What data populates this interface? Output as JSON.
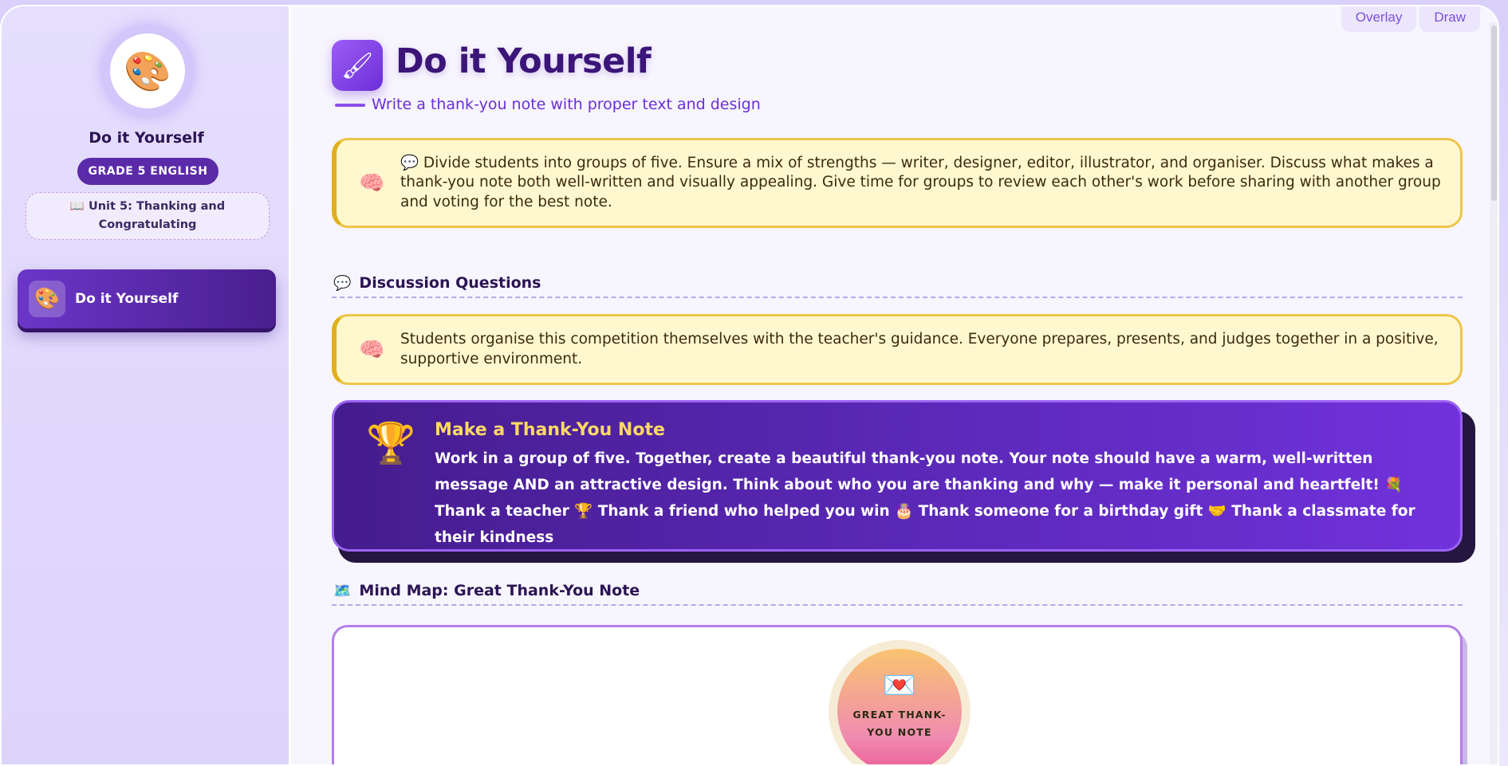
{
  "top_tabs": [
    {
      "label": "Overlay"
    },
    {
      "label": "Draw"
    }
  ],
  "sidebar": {
    "avatar_icon": "palette-icon",
    "title": "Do it Yourself",
    "grade_badge": "GRADE 5 ENGLISH",
    "unit": "📖 Unit 5: Thanking and Congratulating",
    "items": [
      {
        "label": "Do it Yourself",
        "icon": "palette-icon",
        "active": true
      }
    ]
  },
  "header": {
    "title": "Do it Yourself",
    "icon": "paintbrush-icon",
    "subtitle": "Write a thank-you note with proper text and design"
  },
  "teacher_note_1": {
    "icon": "brain-icon",
    "text": "💬 Divide students into groups of five. Ensure a mix of strengths — writer, designer, editor, illustrator, and organiser. Discuss what makes a thank-you note both well-written and visually appealing. Give time for groups to review each other's work before sharing with another group and voting for the best note."
  },
  "discussion": {
    "icon": "speech-bubble-icon",
    "title": "Discussion Questions"
  },
  "teacher_note_2": {
    "icon": "brain-icon",
    "text": "Students organise this competition themselves with the teacher's guidance. Everyone prepares, presents, and judges together in a positive, supportive environment."
  },
  "challenge": {
    "icon": "trophy-icon",
    "title": "Make a Thank-You Note",
    "text": "Work in a group of five. Together, create a beautiful thank-you note. Your note should have a warm, well-written message AND an attractive design. Think about who you are thanking and why — make it personal and heartfelt! 💐 Thank a teacher 🏆 Thank a friend who helped you win 🎂 Thank someone for a birthday gift 🤝 Thank a classmate for their kindness"
  },
  "mindmap": {
    "icon": "map-icon",
    "title": "Mind Map: Great Thank-You Note",
    "center_icon": "love-letter-icon",
    "center_label": "GREAT THANK-YOU NOTE"
  }
}
